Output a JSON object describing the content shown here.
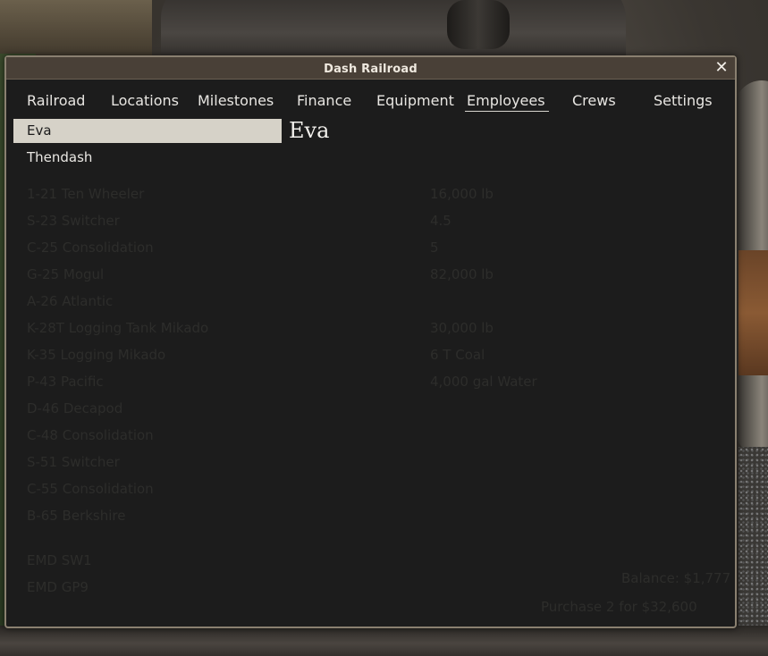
{
  "window": {
    "title": "Dash Railroad",
    "close_glyph": "✕"
  },
  "tabs": [
    {
      "label": "Railroad"
    },
    {
      "label": "Locations"
    },
    {
      "label": "Milestones"
    },
    {
      "label": "Finance"
    },
    {
      "label": "Equipment"
    },
    {
      "label": "Employees"
    },
    {
      "label": "Crews"
    },
    {
      "label": "Settings"
    }
  ],
  "active_tab": "Employees",
  "employees": {
    "items": [
      {
        "name": "Eva",
        "selected": true
      },
      {
        "name": "Thendash",
        "selected": false
      }
    ]
  },
  "detail": {
    "name": "Eva"
  },
  "ghost": {
    "list": [
      "1-21 Ten Wheeler",
      "S-23 Switcher",
      "C-25 Consolidation",
      "G-25 Mogul",
      "A-26 Atlantic",
      "K-28T Logging Tank Mikado",
      "K-35 Logging Mikado",
      "P-43 Pacific",
      "D-46 Decapod",
      "C-48 Consolidation",
      "S-51 Switcher",
      "C-55 Consolidation",
      "B-65 Berkshire",
      "EMD SW1",
      "EMD GP9"
    ],
    "values": [
      "16,000 lb",
      "4.5",
      "5",
      "82,000 lb",
      "30,000 lb",
      "6 T Coal",
      "4,000 gal Water"
    ],
    "balance": "Balance: $1,777",
    "purchase": "Purchase 2 for $32,600"
  }
}
